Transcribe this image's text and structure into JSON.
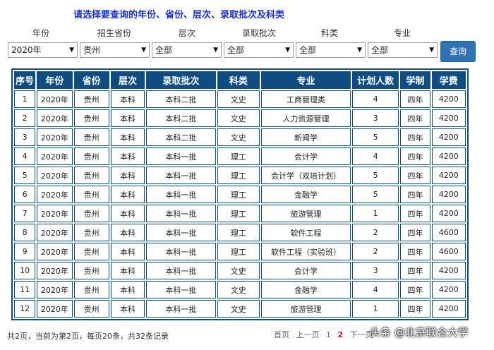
{
  "prompt": "请选择要查询的年份、省份、层次、录取批次及科类",
  "filters": {
    "year": {
      "label": "年份",
      "value": "2020年"
    },
    "province": {
      "label": "招生省份",
      "value": "贵州"
    },
    "level": {
      "label": "层次",
      "value": "全部"
    },
    "batch": {
      "label": "录取批次",
      "value": "全部"
    },
    "category": {
      "label": "科类",
      "value": "全部"
    },
    "major": {
      "label": "专业",
      "value": "全部"
    }
  },
  "query_button": "查询",
  "table": {
    "headers": [
      "序号",
      "年份",
      "省份",
      "层次",
      "录取批次",
      "科类",
      "专业",
      "计划人数",
      "学制",
      "学费"
    ],
    "rows": [
      [
        "1",
        "2020年",
        "贵州",
        "本科",
        "本科二批",
        "文史",
        "工商管理类",
        "4",
        "四年",
        "4200"
      ],
      [
        "2",
        "2020年",
        "贵州",
        "本科",
        "本科二批",
        "文史",
        "人力资源管理",
        "3",
        "四年",
        "4200"
      ],
      [
        "3",
        "2020年",
        "贵州",
        "本科",
        "本科二批",
        "文史",
        "新闻学",
        "5",
        "四年",
        "4200"
      ],
      [
        "4",
        "2020年",
        "贵州",
        "本科",
        "本科一批",
        "理工",
        "会计学",
        "4",
        "四年",
        "4200"
      ],
      [
        "5",
        "2020年",
        "贵州",
        "本科",
        "本科一批",
        "理工",
        "会计学（双培计划）",
        "5",
        "四年",
        "4200"
      ],
      [
        "6",
        "2020年",
        "贵州",
        "本科",
        "本科一批",
        "理工",
        "金融学",
        "5",
        "四年",
        "4200"
      ],
      [
        "7",
        "2020年",
        "贵州",
        "本科",
        "本科一批",
        "理工",
        "旅游管理",
        "1",
        "四年",
        "4200"
      ],
      [
        "8",
        "2020年",
        "贵州",
        "本科",
        "本科一批",
        "理工",
        "软件工程",
        "2",
        "四年",
        "4600"
      ],
      [
        "9",
        "2020年",
        "贵州",
        "本科",
        "本科一批",
        "理工",
        "软件工程（实验班）",
        "2",
        "四年",
        "4600"
      ],
      [
        "10",
        "2020年",
        "贵州",
        "本科",
        "本科一批",
        "文史",
        "会计学",
        "3",
        "四年",
        "4200"
      ],
      [
        "11",
        "2020年",
        "贵州",
        "本科",
        "本科一批",
        "文史",
        "金融学",
        "4",
        "四年",
        "4200"
      ],
      [
        "12",
        "2020年",
        "贵州",
        "本科",
        "本科一批",
        "文史",
        "旅游管理",
        "1",
        "四年",
        "4200"
      ]
    ]
  },
  "footer": {
    "summary": "共2页，当前为第2页，每页20条，共32条记录",
    "pager": {
      "first": "首页",
      "prev": "上一页",
      "page1": "1",
      "page2": "2",
      "next": "下一页"
    }
  },
  "watermark": "头条 @北京联合大学",
  "colors": {
    "header_bg": "#0f4c81",
    "prompt": "#1a2fd4",
    "button": "#2f73b3",
    "current_page": "#d01010"
  }
}
